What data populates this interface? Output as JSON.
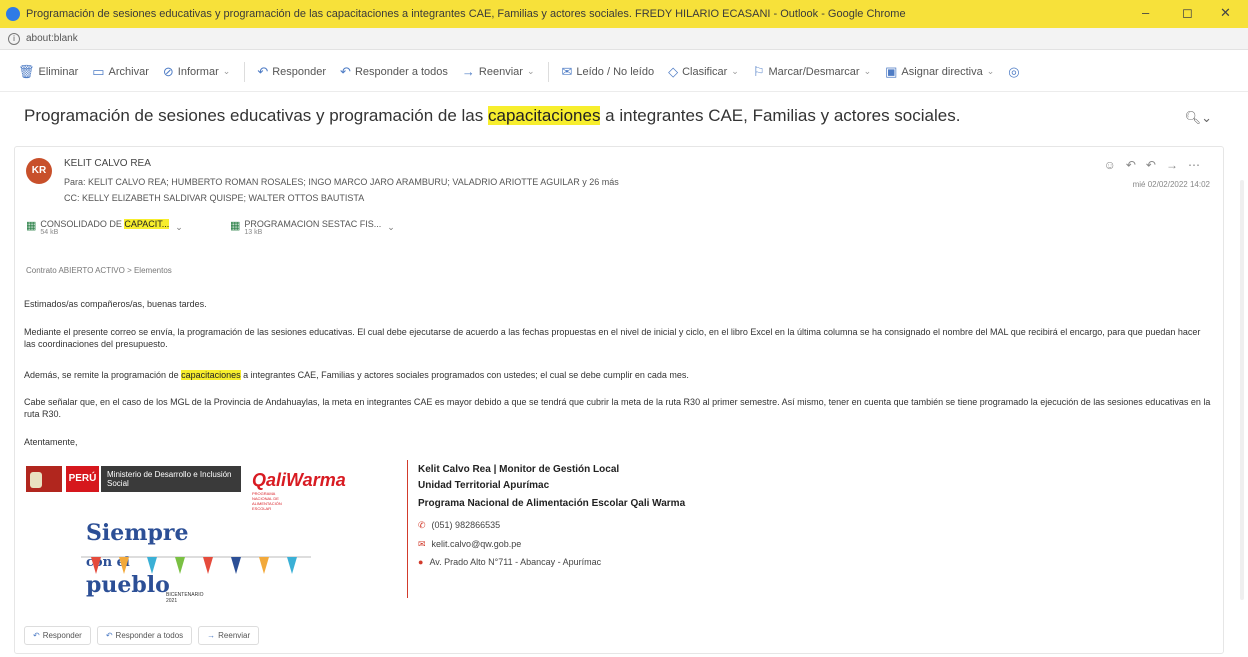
{
  "window": {
    "title": "Programación de sesiones educativas y programación de las capacitaciones a integrantes CAE, Familias y actores sociales. FREDY HILARIO ECASANI - Outlook - Google Chrome",
    "minimize": "–",
    "restore": "◻",
    "close": "✕"
  },
  "address_bar": {
    "url": "about:blank"
  },
  "toolbar": [
    {
      "icon": "🗑",
      "label": "Eliminar"
    },
    {
      "icon": "▭",
      "label": "Archivar"
    },
    {
      "icon": "⊘",
      "label": "Informar",
      "dropdown": true
    },
    {
      "icon": "↶",
      "label": "Responder"
    },
    {
      "icon": "↶",
      "label": "Responder a todos"
    },
    {
      "icon": "→",
      "label": "Reenviar",
      "dropdown": true
    },
    {
      "icon": "✉",
      "label": "Leído / No leído"
    },
    {
      "icon": "◇",
      "label": "Clasificar",
      "dropdown": true
    },
    {
      "icon": "⚐",
      "label": "Marcar/Desmarcar",
      "dropdown": true
    },
    {
      "icon": "▣",
      "label": "Asignar directiva",
      "dropdown": true
    }
  ],
  "subject": {
    "before": "Programación de sesiones educativas y programación de las ",
    "highlight": "capacitaciones",
    "after": " a integrantes CAE, Familias y actores sociales."
  },
  "message": {
    "avatar_initials": "KR",
    "sender": "KELIT CALVO REA",
    "to_line": "Para: KELIT CALVO REA; HUMBERTO ROMAN ROSALES; INGO MARCO JARO ARAMBURU; VALADRIO ARIOTTE AGUILAR y 26 más",
    "cc_line": "CC: KELLY ELIZABETH SALDIVAR QUISPE; WALTER OTTOS BAUTISTA",
    "date": "mié 02/02/2022 14:02",
    "attachments": [
      {
        "name_before": "CONSOLIDADO DE ",
        "name_highlight": "CAPACIT...",
        "size": "54 kB"
      },
      {
        "name_before": "PROGRAMACION SESTAC FIS...",
        "name_highlight": "",
        "size": "13 kB"
      }
    ],
    "folder": "Contrato ABIERTO ACTIVO  >  Elementos",
    "greeting": "Estimados/as compañeros/as, buenas tardes.",
    "p1": "Mediante el presente correo se envía, la programación de las sesiones educativas. El cual debe ejecutarse de acuerdo a las fechas propuestas en el nivel de inicial y ciclo, en el libro Excel en la última columna se ha consignado el nombre del MAL que recibirá el encargo, para que puedan hacer las coordinaciones del presupuesto.",
    "p2_before": "Además, se remite la programación de ",
    "p2_highlight": "capacitaciones",
    "p2_after": " a integrantes CAE, Familias y actores sociales programados con ustedes; el cual se debe cumplir en cada mes.",
    "p3": "Cabe señalar que, en el caso de los MGL de la Provincia de Andahuaylas, la meta en integrantes CAE es mayor debido a que se tendrá que cubrir la meta de la ruta R30 al primer semestre. Así mismo, tener en cuenta que también se tiene programado la ejecución de las sesiones educativas en la ruta R30.",
    "closing": "Atentamente,"
  },
  "signature": {
    "peru": "PERÚ",
    "ministry": "Ministerio de Desarrollo e Inclusión Social",
    "qw": "QaliWarma",
    "qw_sub": "PROGRAMA NACIONAL DE ALIMENTACIÓN ESCOLAR",
    "siempre_a": "Siempre ",
    "siempre_b": "con el",
    "siempre_c": " pueblo",
    "bicentenario": "BICENTENARIO 2021",
    "name_line": "Kelit Calvo Rea | Monitor de Gestión Local",
    "unit": "Unidad Territorial Apurímac",
    "program": "Programa Nacional de Alimentación Escolar Qali Warma",
    "phone": "(051) 982866535",
    "email": "kelit.calvo@qw.gob.pe",
    "address": "Av. Prado Alto N°711 - Abancay - Apurímac"
  },
  "reply_bar": [
    {
      "icon": "↶",
      "label": "Responder"
    },
    {
      "icon": "↶",
      "label": "Responder a todos"
    },
    {
      "icon": "→",
      "label": "Reenviar"
    }
  ],
  "colors": {
    "title_bar": "#f7e13a",
    "highlight": "#f7ee2d",
    "accent": "#4e7cc5",
    "avatar": "#c8502b",
    "signature_line": "#d23b2c"
  }
}
